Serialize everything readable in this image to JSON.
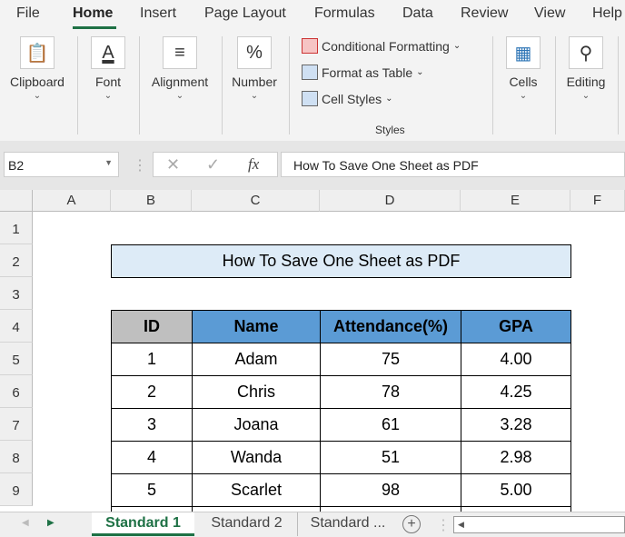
{
  "menu": [
    "File",
    "Home",
    "Insert",
    "Page Layout",
    "Formulas",
    "Data",
    "Review",
    "View",
    "Help"
  ],
  "ribbon": {
    "groups": [
      "Clipboard",
      "Font",
      "Alignment",
      "Number",
      "Cells",
      "Editing"
    ],
    "styles": {
      "items": [
        "Conditional Formatting",
        "Format as Table",
        "Cell Styles"
      ],
      "label": "Styles"
    }
  },
  "formula_bar": {
    "name_box": "B2",
    "fx": "fx",
    "formula": "How To Save One Sheet as PDF"
  },
  "columns": [
    "A",
    "B",
    "C",
    "D",
    "E",
    "F"
  ],
  "rows": [
    "1",
    "2",
    "3",
    "4",
    "5",
    "6",
    "7",
    "8",
    "9"
  ],
  "sheet": {
    "title": "How To Save One Sheet as PDF",
    "headers": [
      "ID",
      "Name",
      "Attendance(%)",
      "GPA"
    ],
    "data": [
      [
        "1",
        "Adam",
        "75",
        "4.00"
      ],
      [
        "2",
        "Chris",
        "78",
        "4.25"
      ],
      [
        "3",
        "Joana",
        "61",
        "3.28"
      ],
      [
        "4",
        "Wanda",
        "51",
        "2.98"
      ],
      [
        "5",
        "Scarlet",
        "98",
        "5.00"
      ]
    ]
  },
  "tabs": [
    "Standard 1",
    "Standard 2",
    "Standard ..."
  ],
  "colors": {
    "accent": "#1e7145",
    "title_fill": "#ddebf7",
    "header_blue": "#5b9bd5",
    "header_gray": "#bfbfbf"
  }
}
